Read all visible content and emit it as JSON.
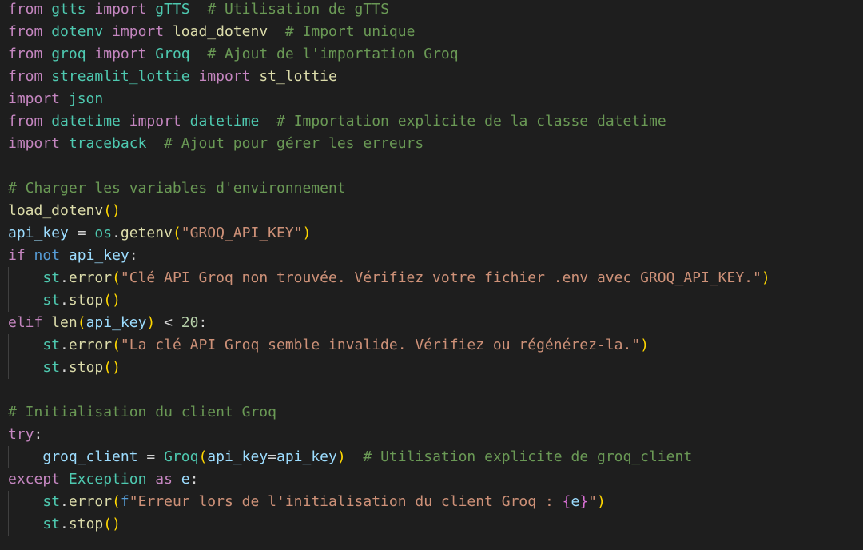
{
  "editor": {
    "language": "python",
    "theme": "dark",
    "lines": [
      {
        "tokens": [
          {
            "t": "from",
            "c": "kw-ctl"
          },
          {
            "t": " ",
            "c": ""
          },
          {
            "t": "gtts",
            "c": "mod"
          },
          {
            "t": " ",
            "c": ""
          },
          {
            "t": "import",
            "c": "kw-ctl"
          },
          {
            "t": " ",
            "c": ""
          },
          {
            "t": "gTTS",
            "c": "mod"
          },
          {
            "t": "  ",
            "c": ""
          },
          {
            "t": "# Utilisation de gTTS",
            "c": "cmt"
          }
        ]
      },
      {
        "tokens": [
          {
            "t": "from",
            "c": "kw-ctl"
          },
          {
            "t": " ",
            "c": ""
          },
          {
            "t": "dotenv",
            "c": "mod"
          },
          {
            "t": " ",
            "c": ""
          },
          {
            "t": "import",
            "c": "kw-ctl"
          },
          {
            "t": " ",
            "c": ""
          },
          {
            "t": "load_dotenv",
            "c": "fn"
          },
          {
            "t": "  ",
            "c": ""
          },
          {
            "t": "# Import unique",
            "c": "cmt"
          }
        ]
      },
      {
        "tokens": [
          {
            "t": "from",
            "c": "kw-ctl"
          },
          {
            "t": " ",
            "c": ""
          },
          {
            "t": "groq",
            "c": "mod"
          },
          {
            "t": " ",
            "c": ""
          },
          {
            "t": "import",
            "c": "kw-ctl"
          },
          {
            "t": " ",
            "c": ""
          },
          {
            "t": "Groq",
            "c": "mod"
          },
          {
            "t": "  ",
            "c": ""
          },
          {
            "t": "# Ajout de l'importation Groq",
            "c": "cmt"
          }
        ]
      },
      {
        "tokens": [
          {
            "t": "from",
            "c": "kw-ctl"
          },
          {
            "t": " ",
            "c": ""
          },
          {
            "t": "streamlit_lottie",
            "c": "mod"
          },
          {
            "t": " ",
            "c": ""
          },
          {
            "t": "import",
            "c": "kw-ctl"
          },
          {
            "t": " ",
            "c": ""
          },
          {
            "t": "st_lottie",
            "c": "fn"
          }
        ]
      },
      {
        "tokens": [
          {
            "t": "import",
            "c": "kw-ctl"
          },
          {
            "t": " ",
            "c": ""
          },
          {
            "t": "json",
            "c": "mod"
          }
        ]
      },
      {
        "tokens": [
          {
            "t": "from",
            "c": "kw-ctl"
          },
          {
            "t": " ",
            "c": ""
          },
          {
            "t": "datetime",
            "c": "mod"
          },
          {
            "t": " ",
            "c": ""
          },
          {
            "t": "import",
            "c": "kw-ctl"
          },
          {
            "t": " ",
            "c": ""
          },
          {
            "t": "datetime",
            "c": "mod"
          },
          {
            "t": "  ",
            "c": ""
          },
          {
            "t": "# Importation explicite de la classe datetime",
            "c": "cmt"
          }
        ]
      },
      {
        "tokens": [
          {
            "t": "import",
            "c": "kw-ctl"
          },
          {
            "t": " ",
            "c": ""
          },
          {
            "t": "traceback",
            "c": "mod"
          },
          {
            "t": "  ",
            "c": ""
          },
          {
            "t": "# Ajout pour gérer les erreurs",
            "c": "cmt"
          }
        ]
      },
      {
        "tokens": []
      },
      {
        "tokens": [
          {
            "t": "# Charger les variables d'environnement",
            "c": "cmt"
          }
        ]
      },
      {
        "tokens": [
          {
            "t": "load_dotenv",
            "c": "fn"
          },
          {
            "t": "()",
            "c": "brk1"
          }
        ]
      },
      {
        "tokens": [
          {
            "t": "api_key",
            "c": "var"
          },
          {
            "t": " = ",
            "c": "op"
          },
          {
            "t": "os",
            "c": "mod"
          },
          {
            "t": ".",
            "c": "op"
          },
          {
            "t": "getenv",
            "c": "fn"
          },
          {
            "t": "(",
            "c": "brk1"
          },
          {
            "t": "\"GROQ_API_KEY\"",
            "c": "str"
          },
          {
            "t": ")",
            "c": "brk1"
          }
        ]
      },
      {
        "tokens": [
          {
            "t": "if",
            "c": "kw-ctl"
          },
          {
            "t": " ",
            "c": ""
          },
          {
            "t": "not",
            "c": "kw"
          },
          {
            "t": " ",
            "c": ""
          },
          {
            "t": "api_key",
            "c": "var"
          },
          {
            "t": ":",
            "c": "op"
          }
        ]
      },
      {
        "tokens": [
          {
            "t": "    ",
            "c": ""
          },
          {
            "t": "st",
            "c": "mod"
          },
          {
            "t": ".",
            "c": "op"
          },
          {
            "t": "error",
            "c": "fn"
          },
          {
            "t": "(",
            "c": "brk1"
          },
          {
            "t": "\"Clé API Groq non trouvée. Vérifiez votre fichier .env avec GROQ_API_KEY.\"",
            "c": "str"
          },
          {
            "t": ")",
            "c": "brk1"
          }
        ]
      },
      {
        "tokens": [
          {
            "t": "    ",
            "c": ""
          },
          {
            "t": "st",
            "c": "mod"
          },
          {
            "t": ".",
            "c": "op"
          },
          {
            "t": "stop",
            "c": "fn"
          },
          {
            "t": "()",
            "c": "brk1"
          }
        ]
      },
      {
        "tokens": [
          {
            "t": "elif",
            "c": "kw-ctl"
          },
          {
            "t": " ",
            "c": ""
          },
          {
            "t": "len",
            "c": "fn"
          },
          {
            "t": "(",
            "c": "brk1"
          },
          {
            "t": "api_key",
            "c": "var"
          },
          {
            "t": ")",
            "c": "brk1"
          },
          {
            "t": " < ",
            "c": "op"
          },
          {
            "t": "20",
            "c": "num"
          },
          {
            "t": ":",
            "c": "op"
          }
        ]
      },
      {
        "tokens": [
          {
            "t": "    ",
            "c": ""
          },
          {
            "t": "st",
            "c": "mod"
          },
          {
            "t": ".",
            "c": "op"
          },
          {
            "t": "error",
            "c": "fn"
          },
          {
            "t": "(",
            "c": "brk1"
          },
          {
            "t": "\"La clé API Groq semble invalide. Vérifiez ou régénérez-la.\"",
            "c": "str"
          },
          {
            "t": ")",
            "c": "brk1"
          }
        ]
      },
      {
        "tokens": [
          {
            "t": "    ",
            "c": ""
          },
          {
            "t": "st",
            "c": "mod"
          },
          {
            "t": ".",
            "c": "op"
          },
          {
            "t": "stop",
            "c": "fn"
          },
          {
            "t": "()",
            "c": "brk1"
          }
        ]
      },
      {
        "tokens": []
      },
      {
        "tokens": [
          {
            "t": "# Initialisation du client Groq",
            "c": "cmt"
          }
        ]
      },
      {
        "tokens": [
          {
            "t": "try",
            "c": "kw-ctl"
          },
          {
            "t": ":",
            "c": "op"
          }
        ]
      },
      {
        "tokens": [
          {
            "t": "    ",
            "c": ""
          },
          {
            "t": "groq_client",
            "c": "var"
          },
          {
            "t": " = ",
            "c": "op"
          },
          {
            "t": "Groq",
            "c": "mod"
          },
          {
            "t": "(",
            "c": "brk1"
          },
          {
            "t": "api_key",
            "c": "var"
          },
          {
            "t": "=",
            "c": "op"
          },
          {
            "t": "api_key",
            "c": "var"
          },
          {
            "t": ")",
            "c": "brk1"
          },
          {
            "t": "  ",
            "c": ""
          },
          {
            "t": "# Utilisation explicite de groq_client",
            "c": "cmt"
          }
        ]
      },
      {
        "tokens": [
          {
            "t": "except",
            "c": "kw-ctl"
          },
          {
            "t": " ",
            "c": ""
          },
          {
            "t": "Exception",
            "c": "mod"
          },
          {
            "t": " ",
            "c": ""
          },
          {
            "t": "as",
            "c": "kw-ctl"
          },
          {
            "t": " ",
            "c": ""
          },
          {
            "t": "e",
            "c": "var"
          },
          {
            "t": ":",
            "c": "op"
          }
        ]
      },
      {
        "tokens": [
          {
            "t": "    ",
            "c": ""
          },
          {
            "t": "st",
            "c": "mod"
          },
          {
            "t": ".",
            "c": "op"
          },
          {
            "t": "error",
            "c": "fn"
          },
          {
            "t": "(",
            "c": "brk1"
          },
          {
            "t": "f",
            "c": "kw"
          },
          {
            "t": "\"Erreur lors de l'initialisation du client Groq : ",
            "c": "str"
          },
          {
            "t": "{",
            "c": "brk2"
          },
          {
            "t": "e",
            "c": "var"
          },
          {
            "t": "}",
            "c": "brk2"
          },
          {
            "t": "\"",
            "c": "str"
          },
          {
            "t": ")",
            "c": "brk1"
          }
        ]
      },
      {
        "tokens": [
          {
            "t": "    ",
            "c": ""
          },
          {
            "t": "st",
            "c": "mod"
          },
          {
            "t": ".",
            "c": "op"
          },
          {
            "t": "stop",
            "c": "fn"
          },
          {
            "t": "()",
            "c": "brk1"
          }
        ]
      }
    ]
  }
}
